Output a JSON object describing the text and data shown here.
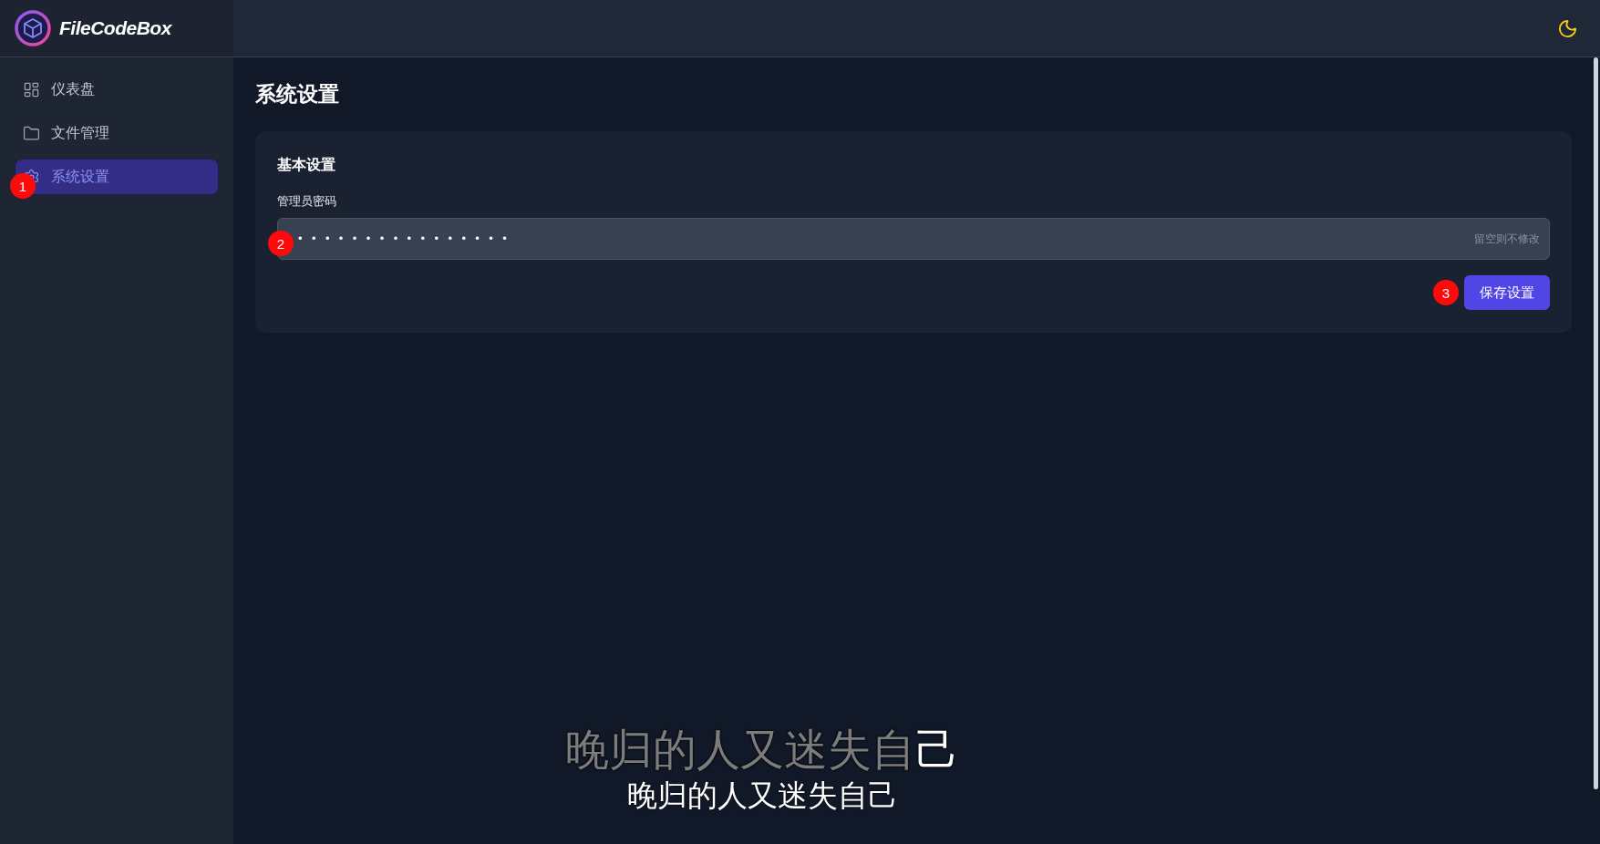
{
  "header": {
    "brand": "FileCodeBox"
  },
  "sidebar": {
    "items": [
      {
        "label": "仪表盘",
        "selected": false
      },
      {
        "label": "文件管理",
        "selected": false
      },
      {
        "label": "系统设置",
        "selected": true,
        "marker": "1"
      }
    ]
  },
  "page": {
    "title": "系统设置"
  },
  "card": {
    "title": "基本设置",
    "fields": [
      {
        "label": "管理员密码",
        "value": "••••••••••••••••",
        "hint": "留空则不修改",
        "marker": "2"
      }
    ],
    "button": {
      "label": "保存设置",
      "marker": "3"
    }
  },
  "subtitles": {
    "karaoke_line": [
      {
        "text": "晚归的人又迷失自",
        "highlighted": false
      },
      {
        "text": "己",
        "highlighted": true
      }
    ],
    "line": "晚归的人又迷失自己"
  }
}
